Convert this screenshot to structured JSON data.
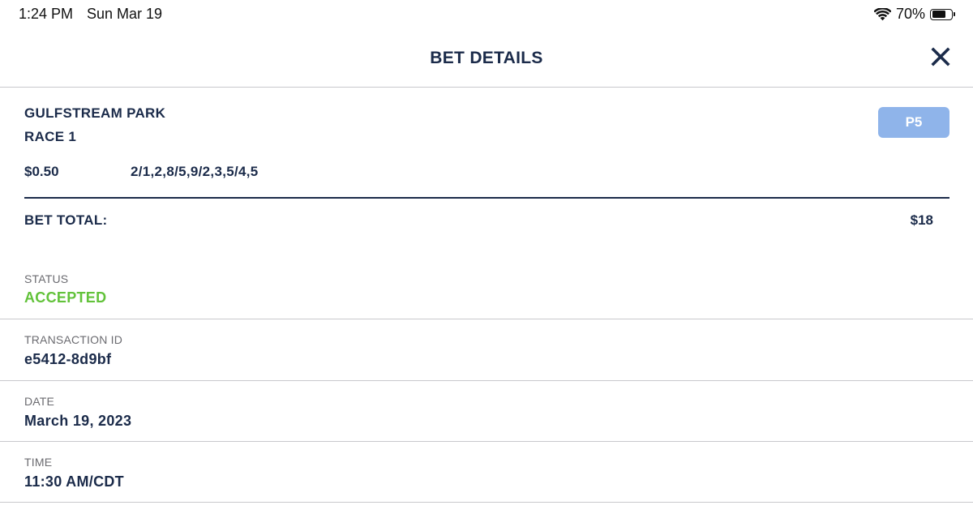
{
  "status_bar": {
    "time": "1:24 PM",
    "date": "Sun Mar 19",
    "battery_percent": "70%",
    "battery_level": 0.7,
    "wifi_icon": "wifi-icon",
    "battery_icon": "battery-icon"
  },
  "header": {
    "title": "BET DETAILS",
    "close_icon": "close-icon"
  },
  "bet": {
    "track": "GULFSTREAM PARK",
    "race": "RACE 1",
    "bet_type": "P5",
    "amount": "$0.50",
    "selections": "2/1,2,8/5,9/2,3,5/4,5",
    "total_label": "BET TOTAL:",
    "total_value": "$18"
  },
  "details": {
    "status": {
      "label": "STATUS",
      "value": "ACCEPTED"
    },
    "transaction": {
      "label": "TRANSACTION ID",
      "value": "e5412-8d9bf"
    },
    "date": {
      "label": "DATE",
      "value": "March 19, 2023"
    },
    "time": {
      "label": "TIME",
      "value": "11:30 AM/CDT"
    }
  },
  "colors": {
    "primary_text": "#1b2b4a",
    "accepted": "#62c23a",
    "badge": "#8fb4ea",
    "label_gray": "#6b6b70",
    "divider": "#c8c8cc"
  }
}
